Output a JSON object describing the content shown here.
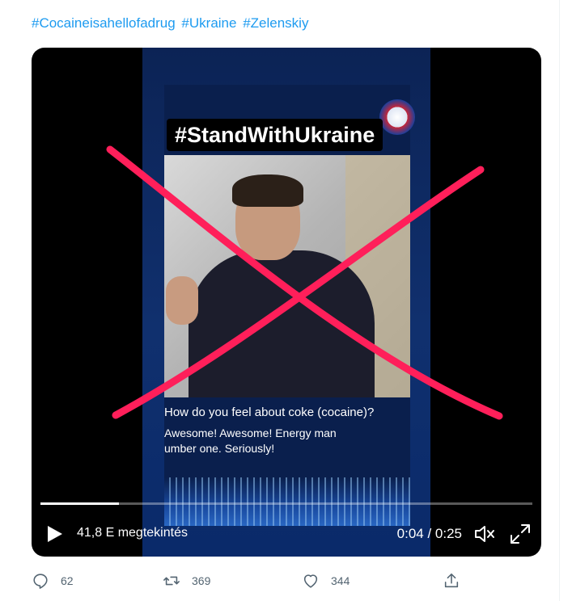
{
  "tweet": {
    "hashtags": [
      "#Cocaineisahellofadrug",
      "#Ukraine",
      "#Zelenskiy"
    ]
  },
  "video": {
    "banner_text": "#StandWithUkraine",
    "caption_question": "How do you feel about coke (cocaine)?",
    "caption_answer_line1": "Awesome! Awesome! Energy man",
    "caption_answer_line2": "umber one. Seriously!",
    "views_text": "41,8 E megtekintés",
    "time_text": "0:04 / 0:25",
    "progress_fraction": 0.16,
    "cross_color": "#ff1f5a"
  },
  "actions": {
    "reply_count": "62",
    "retweet_count": "369",
    "like_count": "344"
  },
  "colors": {
    "accent": "#1d9bf0",
    "muted": "#536471"
  }
}
